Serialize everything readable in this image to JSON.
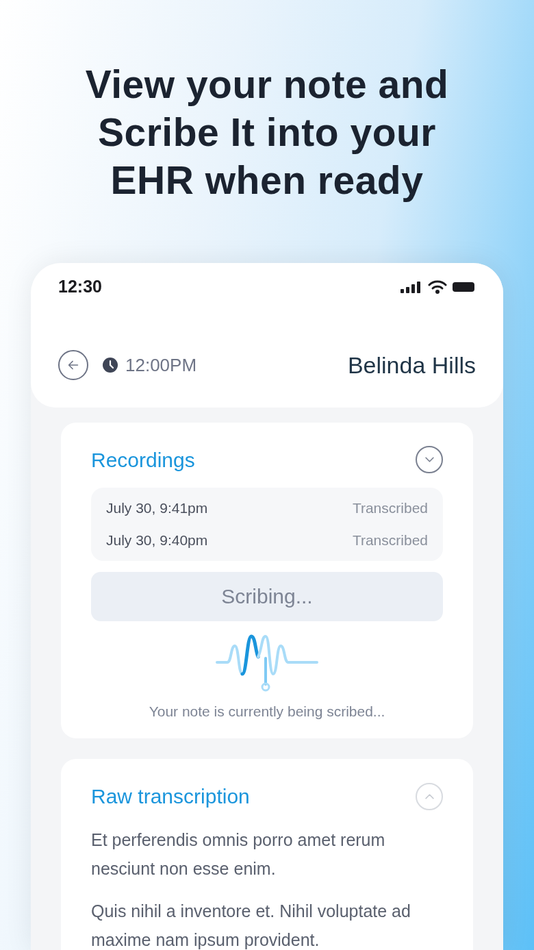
{
  "headline": "View your note and Scribe It into your EHR when ready",
  "status_bar": {
    "time": "12:30"
  },
  "header": {
    "time": "12:00PM",
    "patient": "Belinda Hills"
  },
  "recordings": {
    "title": "Recordings",
    "expanded": false,
    "items": [
      {
        "date": "July 30, 9:41pm",
        "status": "Transcribed"
      },
      {
        "date": "July 30, 9:40pm",
        "status": "Transcribed"
      }
    ],
    "button": "Scribing...",
    "message": "Your note is currently being scribed..."
  },
  "transcription": {
    "title": "Raw transcription",
    "expanded": true,
    "paragraphs": [
      "Et perferendis omnis porro amet rerum nesciunt non esse enim.",
      "Quis nihil a inventore et. Nihil voluptate ad maxime nam ipsum provident."
    ]
  }
}
